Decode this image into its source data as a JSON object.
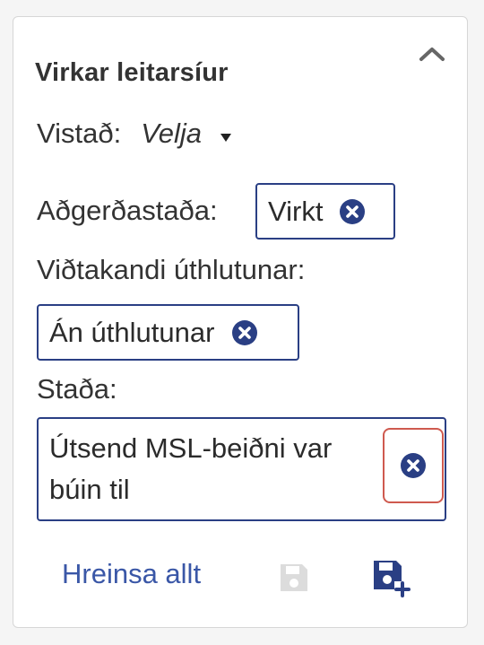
{
  "panel": {
    "title": "Virkar leitarsíur",
    "collapse_icon": "chevron-up-icon"
  },
  "filters": {
    "location": {
      "label": "Vistað:",
      "value": "Velja",
      "icon": "caret-down-icon"
    },
    "action_status": {
      "label": "Aðgerðastaða:",
      "chip": "Virkt"
    },
    "assignee": {
      "label": "Viðtakandi úthlutunar:",
      "chip": "Án úthlutunar"
    },
    "status": {
      "label": "Staða:",
      "chip": "Útsend MSL-beiðni var búin til"
    }
  },
  "footer": {
    "clear_all": "Hreinsa allt",
    "save_icon": "save-icon",
    "save_as_new_icon": "save-add-icon"
  },
  "colors": {
    "chip_border": "#2a3f84",
    "remove_icon": "#2a3f84",
    "link": "#3a57a7",
    "highlight": "#cf5a4f",
    "disabled_icon": "#d6d6d6"
  }
}
